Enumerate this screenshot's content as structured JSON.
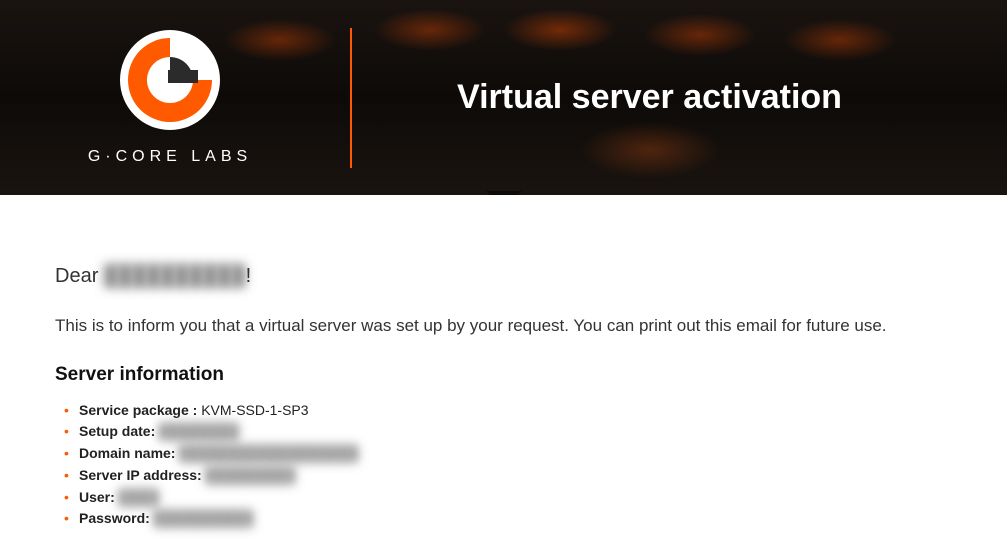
{
  "brand": {
    "name": "G·CORE LABS",
    "accent": "#ff5a00"
  },
  "header": {
    "title": "Virtual server activation"
  },
  "greeting": {
    "prefix": "Dear",
    "name": "██████████",
    "suffix": "!"
  },
  "intro": "This is to inform you that a virtual server was set up by your request. You can print out this email for future use.",
  "server_info": {
    "heading": "Server information",
    "items": [
      {
        "label": "Service package :",
        "value": "KVM-SSD-1-SP3",
        "redacted": false
      },
      {
        "label": "Setup date:",
        "value": "████████",
        "redacted": true
      },
      {
        "label": "Domain name:",
        "value": "██████████████████",
        "redacted": true
      },
      {
        "label": "Server IP address:",
        "value": "█████████",
        "redacted": true
      },
      {
        "label": "User:",
        "value": "████",
        "redacted": true
      },
      {
        "label": "Password:",
        "value": "██████████",
        "redacted": true
      }
    ]
  }
}
